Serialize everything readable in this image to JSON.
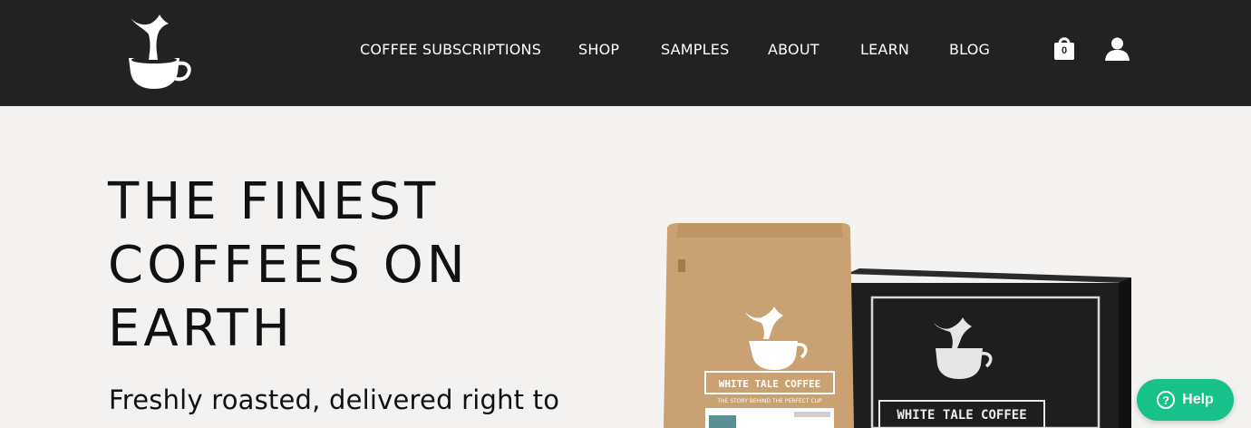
{
  "header": {
    "logo_icon": "whale-tail-coffee-cup-icon",
    "nav": [
      {
        "label": "COFFEE SUBSCRIPTIONS"
      },
      {
        "label": "SHOP"
      },
      {
        "label": "SAMPLES"
      },
      {
        "label": "ABOUT"
      },
      {
        "label": "LEARN"
      },
      {
        "label": "BLOG"
      }
    ],
    "cart": {
      "icon": "shopping-bag-icon",
      "count": "0"
    },
    "account_icon": "user-icon"
  },
  "hero": {
    "title_lines": [
      "THE FINEST",
      "COFFEES ON",
      "EARTH"
    ],
    "subtitle": "Freshly roasted, delivered right to",
    "product": {
      "bag_brand": "WHITE TALE COFFEE",
      "bag_tagline": "THE STORY BEHIND THE PERFECT CUP",
      "box_brand": "WHITE TALE COFFEE"
    }
  },
  "help_widget": {
    "label": "Help",
    "icon": "question-circle-icon"
  },
  "colors": {
    "header_bg": "#222222",
    "page_bg": "#f3f2f0",
    "help_green": "#18c18a",
    "kraft": "#c9a172",
    "box_black": "#1e1e1e"
  }
}
